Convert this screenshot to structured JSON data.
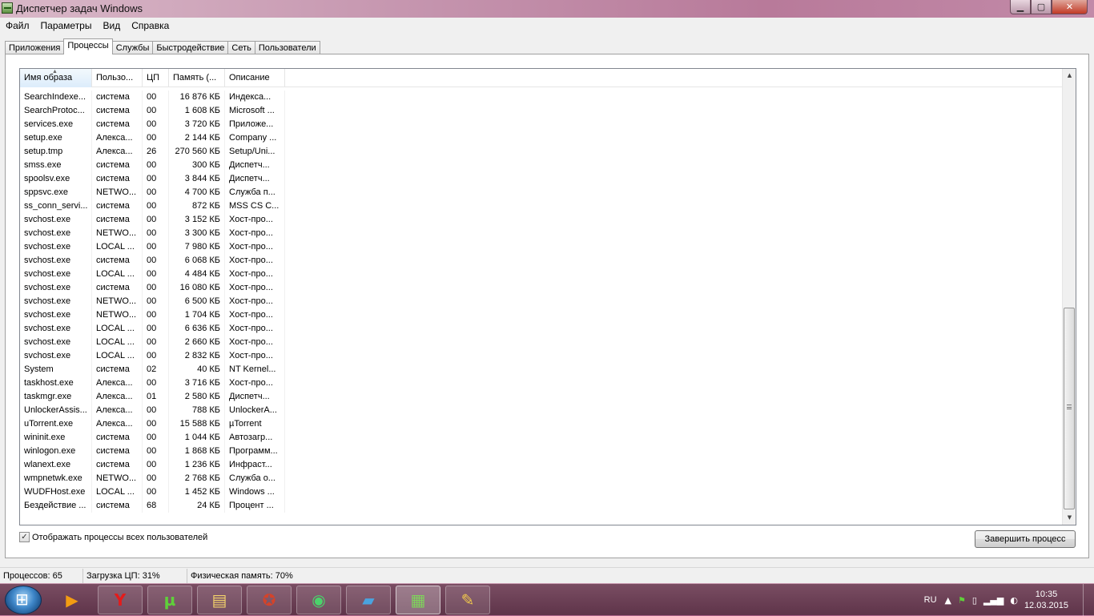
{
  "window": {
    "title": "Диспетчер задач Windows"
  },
  "menu": [
    "Файл",
    "Параметры",
    "Вид",
    "Справка"
  ],
  "tabs": [
    "Приложения",
    "Процессы",
    "Службы",
    "Быстродействие",
    "Сеть",
    "Пользователи"
  ],
  "active_tab": "Процессы",
  "columns": [
    "Имя образа",
    "Пользо...",
    "ЦП",
    "Память (...",
    "Описание"
  ],
  "rows": [
    [
      "SearchIndexe...",
      "система",
      "00",
      "16 876 КБ",
      "Индекса..."
    ],
    [
      "SearchProtoc...",
      "система",
      "00",
      "1 608 КБ",
      "Microsoft ..."
    ],
    [
      "services.exe",
      "система",
      "00",
      "3 720 КБ",
      "Приложе..."
    ],
    [
      "setup.exe",
      "Алекса...",
      "00",
      "2 144 КБ",
      "Company ..."
    ],
    [
      "setup.tmp",
      "Алекса...",
      "26",
      "270 560 КБ",
      "Setup/Uni..."
    ],
    [
      "smss.exe",
      "система",
      "00",
      "300 КБ",
      "Диспетч..."
    ],
    [
      "spoolsv.exe",
      "система",
      "00",
      "3 844 КБ",
      "Диспетч..."
    ],
    [
      "sppsvc.exe",
      "NETWO...",
      "00",
      "4 700 КБ",
      "Служба п..."
    ],
    [
      "ss_conn_servi...",
      "система",
      "00",
      "872 КБ",
      "MSS CS C..."
    ],
    [
      "svchost.exe",
      "система",
      "00",
      "3 152 КБ",
      "Хост-про..."
    ],
    [
      "svchost.exe",
      "NETWO...",
      "00",
      "3 300 КБ",
      "Хост-про..."
    ],
    [
      "svchost.exe",
      "LOCAL ...",
      "00",
      "7 980 КБ",
      "Хост-про..."
    ],
    [
      "svchost.exe",
      "система",
      "00",
      "6 068 КБ",
      "Хост-про..."
    ],
    [
      "svchost.exe",
      "LOCAL ...",
      "00",
      "4 484 КБ",
      "Хост-про..."
    ],
    [
      "svchost.exe",
      "система",
      "00",
      "16 080 КБ",
      "Хост-про..."
    ],
    [
      "svchost.exe",
      "NETWO...",
      "00",
      "6 500 КБ",
      "Хост-про..."
    ],
    [
      "svchost.exe",
      "NETWO...",
      "00",
      "1 704 КБ",
      "Хост-про..."
    ],
    [
      "svchost.exe",
      "LOCAL ...",
      "00",
      "6 636 КБ",
      "Хост-про..."
    ],
    [
      "svchost.exe",
      "LOCAL ...",
      "00",
      "2 660 КБ",
      "Хост-про..."
    ],
    [
      "svchost.exe",
      "LOCAL ...",
      "00",
      "2 832 КБ",
      "Хост-про..."
    ],
    [
      "System",
      "система",
      "02",
      "40 КБ",
      "NT Kernel..."
    ],
    [
      "taskhost.exe",
      "Алекса...",
      "00",
      "3 716 КБ",
      "Хост-про..."
    ],
    [
      "taskmgr.exe",
      "Алекса...",
      "01",
      "2 580 КБ",
      "Диспетч..."
    ],
    [
      "UnlockerAssis...",
      "Алекса...",
      "00",
      "788 КБ",
      "UnlockerA..."
    ],
    [
      "uTorrent.exe",
      "Алекса...",
      "00",
      "15 588 КБ",
      "µTorrent"
    ],
    [
      "wininit.exe",
      "система",
      "00",
      "1 044 КБ",
      "Автозагр..."
    ],
    [
      "winlogon.exe",
      "система",
      "00",
      "1 868 КБ",
      "Программ..."
    ],
    [
      "wlanext.exe",
      "система",
      "00",
      "1 236 КБ",
      "Инфраст..."
    ],
    [
      "wmpnetwk.exe",
      "NETWO...",
      "00",
      "2 768 КБ",
      "Служба о..."
    ],
    [
      "WUDFHost.exe",
      "LOCAL ...",
      "00",
      "1 452 КБ",
      "Windows ..."
    ],
    [
      "Бездействие ...",
      "система",
      "68",
      "24 КБ",
      "Процент ..."
    ]
  ],
  "show_all_users": {
    "label": "Отображать процессы всех пользователей",
    "checked": true,
    "check_glyph": "✓"
  },
  "end_process_button": "Завершить процесс",
  "status": {
    "processes": "Процессов: 65",
    "cpu": "Загрузка ЦП: 31%",
    "memory": "Физическая память: 70%"
  },
  "taskbar": {
    "language": "RU",
    "time": "10:35",
    "date": "12.03.2015",
    "apps": [
      "media-player-icon",
      "yandex-browser-icon",
      "utorrent-icon",
      "file-explorer-icon",
      "game-icon",
      "network-meter-icon",
      "tablet-icon",
      "task-manager-icon",
      "paint-icon"
    ]
  },
  "colors": {
    "accent": "#3399ff",
    "taskbar": "#5e3449"
  }
}
